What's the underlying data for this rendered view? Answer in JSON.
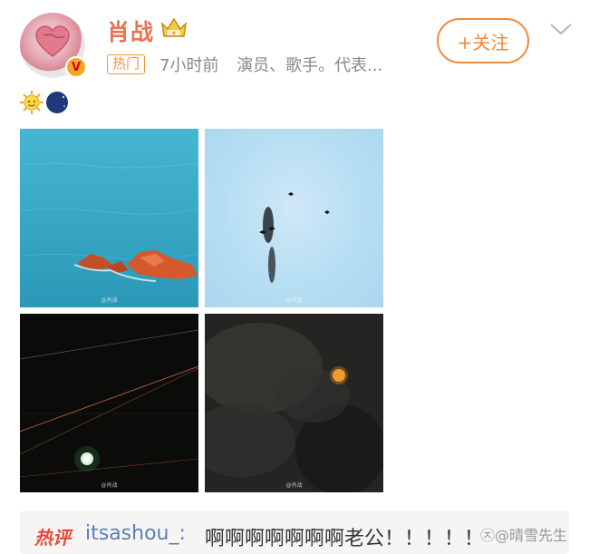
{
  "author": {
    "name": "肖战",
    "verified_badge": "V",
    "hot_tag": "热门",
    "time": "7小时前",
    "description": "演员、歌手。代表..."
  },
  "follow_button": {
    "label": "+关注"
  },
  "icons": {
    "crown": "crown-badge-icon",
    "emoji_1": "sun-face-emoji",
    "emoji_2": "moon-face-emoji",
    "more": "chevron-down-icon"
  },
  "photos": [
    {
      "name": "sea-rocks-photo",
      "watermark": "@肖战"
    },
    {
      "name": "sky-birds-photo",
      "watermark": "@肖战"
    },
    {
      "name": "night-moon-wires-photo",
      "watermark": "@肖战"
    },
    {
      "name": "orange-moon-clouds-photo",
      "watermark": "@肖战"
    }
  ],
  "hot_comment": {
    "tag": "热评",
    "user": "itsashou_:",
    "text": "啊啊啊啊啊啊啊老公！！！！！"
  },
  "site_watermark": "㉨@晴雪先生",
  "colors": {
    "brand_orange": "#eb7350",
    "follow_orange": "#f08a3c",
    "link_blue": "#5b7fb8",
    "hot_red": "#e64a3c"
  }
}
